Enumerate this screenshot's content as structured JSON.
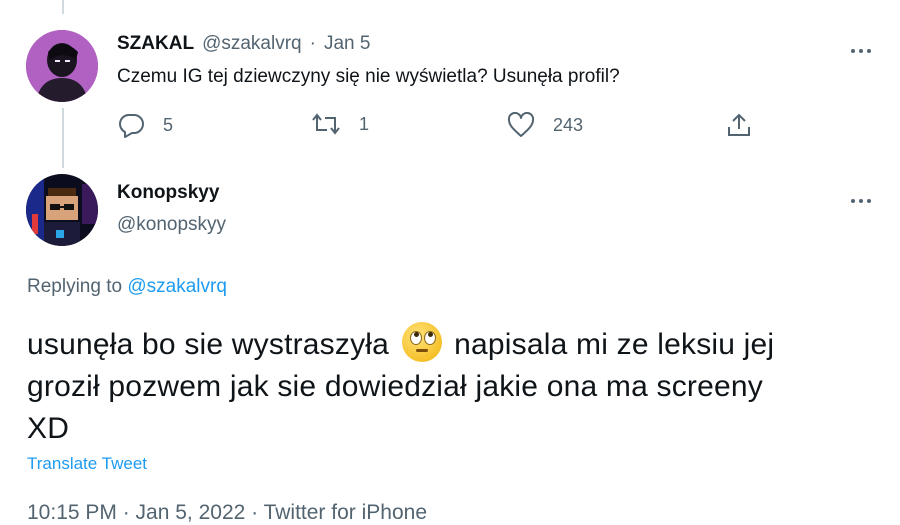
{
  "parent_tweet": {
    "display_name": "SZAKAL",
    "handle": "@szakalvrq",
    "separator": "·",
    "date": "Jan 5",
    "text": "Czemu IG tej dziewczyny się nie wyświetla? Usunęła profil?",
    "replies": "5",
    "retweets": "1",
    "likes": "243"
  },
  "main_tweet": {
    "display_name": "Konopskyy",
    "handle": "@konopskyy",
    "replying_prefix": "Replying to",
    "replying_to": "@szakalvrq",
    "text_part1": "usunęła bo sie wystraszyła",
    "text_part2": "napisala mi ze leksiu jej",
    "text_line2": "groził pozwem jak sie dowiedział jakie ona ma screeny",
    "text_line3": "XD",
    "translate_label": "Translate Tweet",
    "timestamp": "10:15 PM · Jan 5, 2022 · Twitter for iPhone"
  },
  "colors": {
    "link": "#1d9bf0",
    "muted": "#536471",
    "thread_line": "#cfd9de"
  }
}
